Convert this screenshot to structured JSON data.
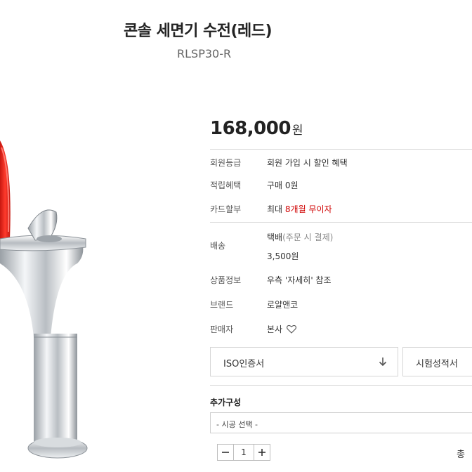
{
  "product": {
    "title": "콘솔 세면기 수전(레드)",
    "model": "RLSP30-R",
    "price": "168,000",
    "currency": "원"
  },
  "info": {
    "membership": {
      "label": "회원등급",
      "value": "회원 가입 시 할인 혜택"
    },
    "points": {
      "label": "적립혜택",
      "value": "구매 0원"
    },
    "card": {
      "label": "카드할부",
      "prefix": "최대 ",
      "highlight": "8개월 무이자"
    },
    "shipping": {
      "label": "배송",
      "method": "택배",
      "method_note": "(주문 시 결제)",
      "fee": "3,500원"
    },
    "details": {
      "label": "상품정보",
      "value": "우측 '자세히' 참조"
    },
    "brand": {
      "label": "브랜드",
      "value": "로얄앤코"
    },
    "seller": {
      "label": "판매자",
      "value": "본사"
    }
  },
  "documents": {
    "iso": "ISO인증서",
    "test_report": "시험성적서"
  },
  "options": {
    "title": "추가구성",
    "select_placeholder": "- 시공 선택 -"
  },
  "quantity": {
    "value": "1",
    "minus": "−",
    "plus": "+"
  },
  "total_label": "총",
  "colors": {
    "accent_red": "#d00000",
    "faucet_red": "#e8261c",
    "chrome": "#c8cdd2"
  }
}
